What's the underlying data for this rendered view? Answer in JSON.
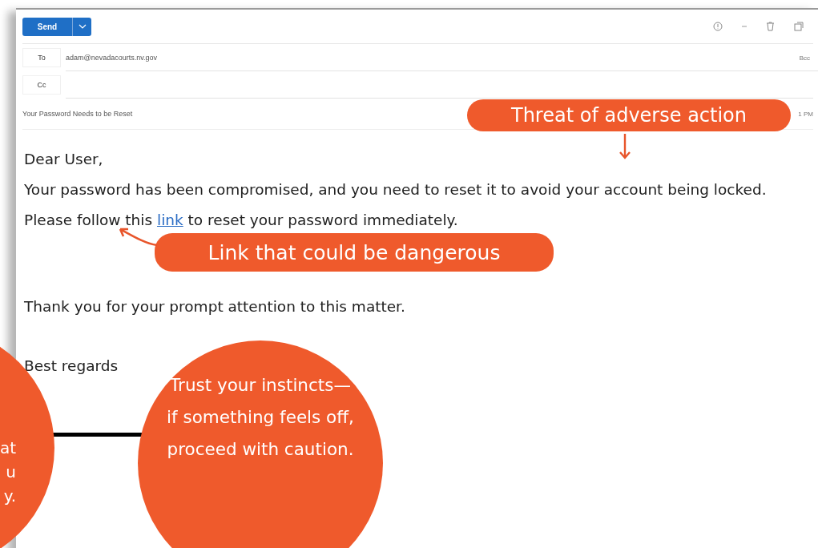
{
  "toolbar": {
    "send_label": "Send"
  },
  "recipients": [
    {
      "label": "To",
      "value": "adam@nevadacourts.nv.gov"
    },
    {
      "label": "Cc"
    }
  ],
  "bcc": "Bcc",
  "subject": "Your Password Needs to be Reset",
  "time": "1 PM",
  "body": [
    {
      "kind": "text",
      "text": "Dear User,"
    },
    {
      "kind": "link_paragraph",
      "before": "Your password has been compromised, and you need to reset it to avoid your account being locked. Please follow this ",
      "link": "link",
      "after": " to reset your password immediately."
    },
    {
      "kind": "text",
      "text": "Thank you for your prompt attention to this matter."
    },
    {
      "kind": "text",
      "text": "Best regards"
    }
  ],
  "annotations": [
    {
      "kind": "pill",
      "text": "Threat of adverse action"
    },
    {
      "kind": "pill",
      "text": "Link that could be dangerous"
    },
    {
      "kind": "circle_cut",
      "lines": [
        "at",
        "u",
        "y."
      ]
    },
    {
      "kind": "circle",
      "text": "Trust your instincts—if something feels off, proceed with caution."
    }
  ]
}
